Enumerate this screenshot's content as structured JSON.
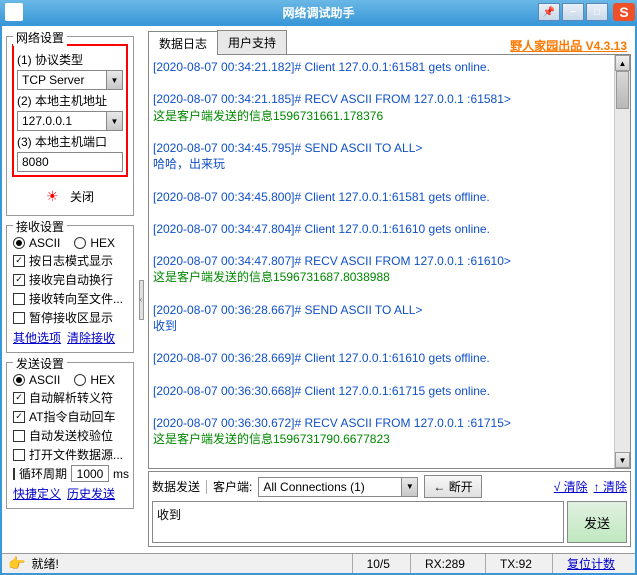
{
  "title": "网络调试助手",
  "brand": "野人家园出品 V4.3.13",
  "tabs": {
    "log": "数据日志",
    "support": "用户支持"
  },
  "groups": {
    "net": "网络设置",
    "recv": "接收设置",
    "send": "发送设置"
  },
  "net": {
    "proto_lbl": "(1) 协议类型",
    "proto_val": "TCP Server",
    "host_lbl": "(2) 本地主机地址",
    "host_val": "127.0.0.1",
    "port_lbl": "(3) 本地主机端口",
    "port_val": "8080",
    "close": "关闭"
  },
  "recv": {
    "ascii": "ASCII",
    "hex": "HEX",
    "r1": "按日志模式显示",
    "r2": "接收完自动换行",
    "r3": "接收转向至文件...",
    "r4": "暂停接收区显示",
    "link1": "其他选项",
    "link2": "清除接收"
  },
  "send": {
    "ascii": "ASCII",
    "hex": "HEX",
    "s1": "自动解析转义符",
    "s2": "AT指令自动回车",
    "s3": "自动发送校验位",
    "s4": "打开文件数据源...",
    "s5_a": "循环周期",
    "s5_b": "1000",
    "s5_c": "ms",
    "link1": "快捷定义",
    "link2": "历史发送"
  },
  "log_lines": [
    {
      "t": "[2020-08-07 00:34:21.182]# Client 127.0.0.1:61581 gets online.",
      "c": "blue"
    },
    {
      "t": " ",
      "c": ""
    },
    {
      "t": "[2020-08-07 00:34:21.185]# RECV ASCII FROM 127.0.0.1 :61581>",
      "c": "blue"
    },
    {
      "t": "这是客户端发送的信息1596731661.178376",
      "c": "green"
    },
    {
      "t": " ",
      "c": ""
    },
    {
      "t": "[2020-08-07 00:34:45.795]# SEND ASCII TO ALL>",
      "c": "blue"
    },
    {
      "t": "哈哈，出来玩",
      "c": "blue"
    },
    {
      "t": " ",
      "c": ""
    },
    {
      "t": "[2020-08-07 00:34:45.800]# Client 127.0.0.1:61581 gets offline.",
      "c": "blue"
    },
    {
      "t": " ",
      "c": ""
    },
    {
      "t": "[2020-08-07 00:34:47.804]# Client 127.0.0.1:61610 gets online.",
      "c": "blue"
    },
    {
      "t": " ",
      "c": ""
    },
    {
      "t": "[2020-08-07 00:34:47.807]# RECV ASCII FROM 127.0.0.1 :61610>",
      "c": "blue"
    },
    {
      "t": "这是客户端发送的信息1596731687.8038988",
      "c": "green"
    },
    {
      "t": " ",
      "c": ""
    },
    {
      "t": "[2020-08-07 00:36:28.667]# SEND ASCII TO ALL>",
      "c": "blue"
    },
    {
      "t": "收到",
      "c": "blue"
    },
    {
      "t": " ",
      "c": ""
    },
    {
      "t": "[2020-08-07 00:36:28.669]# Client 127.0.0.1:61610 gets offline.",
      "c": "blue"
    },
    {
      "t": " ",
      "c": ""
    },
    {
      "t": "[2020-08-07 00:36:30.668]# Client 127.0.0.1:61715 gets online.",
      "c": "blue"
    },
    {
      "t": " ",
      "c": ""
    },
    {
      "t": "[2020-08-07 00:36:30.672]# RECV ASCII FROM 127.0.0.1 :61715>",
      "c": "blue"
    },
    {
      "t": "这是客户端发送的信息1596731790.6677823",
      "c": "green"
    }
  ],
  "sendbar": {
    "label": "数据发送",
    "client": "客户端:",
    "conn": "All Connections (1)",
    "disconnect": "← 断开",
    "clear1": "√ 清除",
    "clear2": "↑ 清除",
    "text": "收到",
    "send": "发送"
  },
  "status": {
    "ready": "就绪!",
    "ratio": "10/5",
    "rx": "RX:289",
    "tx": "TX:92",
    "reset": "复位计数"
  }
}
